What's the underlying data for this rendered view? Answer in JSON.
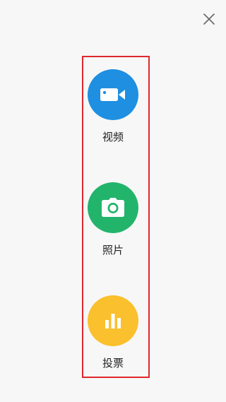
{
  "close": {
    "icon": "close-icon"
  },
  "options": [
    {
      "label": "视频",
      "icon": "video-camera-icon",
      "color": "#1e8fe1"
    },
    {
      "label": "照片",
      "icon": "camera-icon",
      "color": "#23b46b"
    },
    {
      "label": "投票",
      "icon": "bar-chart-icon",
      "color": "#fbc02d"
    }
  ],
  "highlight": {
    "color": "#e0282e"
  }
}
